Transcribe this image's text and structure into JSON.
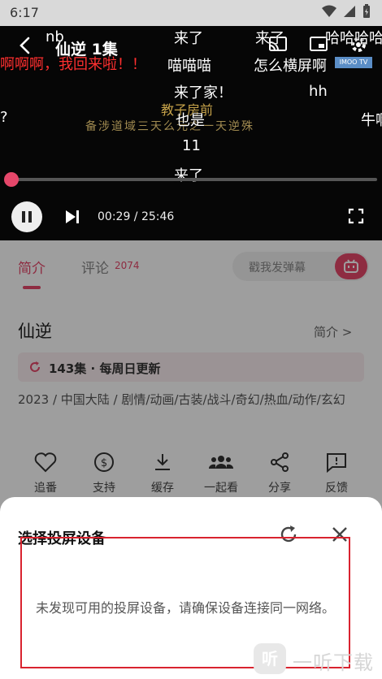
{
  "status_bar": {
    "time": "6:17"
  },
  "player": {
    "title": "仙逆 1集",
    "poster_line1": "教子房前",
    "poster_line2": "备涉道域三天么元之一天逆殊",
    "current_time": "00:29",
    "total_time": "25:46",
    "time_separator": " / ",
    "progress_fraction": 0.02,
    "watermark": "IMOO TV",
    "danmaku": [
      {
        "text": "nb",
        "color": "#ffffff"
      },
      {
        "text": "来了",
        "color": "#ffffff"
      },
      {
        "text": "来了",
        "color": "#ffffff"
      },
      {
        "text": "哈哈哈哈",
        "color": "#ffffff"
      },
      {
        "text": "啊啊啊，我回来啦！！",
        "color": "#ff3030"
      },
      {
        "text": "喵喵喵",
        "color": "#ffffff"
      },
      {
        "text": "怎么横屏啊",
        "color": "#ffffff"
      },
      {
        "text": "来了家！",
        "color": "#ffffff"
      },
      {
        "text": "hh",
        "color": "#ffffff"
      },
      {
        "text": "?",
        "color": "#ffffff"
      },
      {
        "text": "也是",
        "color": "#ffffff"
      },
      {
        "text": "牛啊",
        "color": "#ffffff"
      },
      {
        "text": "11",
        "color": "#ffffff"
      },
      {
        "text": "来了",
        "color": "#ffffff"
      }
    ]
  },
  "tabs": {
    "intro": "简介",
    "comments": "评论",
    "comments_count": "2074",
    "danmaku_placeholder": "戳我发弹幕"
  },
  "show": {
    "title": "仙逆",
    "intro_link": "简介 >",
    "update": "143集 · 每周日更新",
    "tags": "2023 / 中国大陆 / 剧情/动画/古装/战斗/奇幻/热血/动作/玄幻"
  },
  "actions": [
    {
      "label": "追番",
      "icon": "heart-icon"
    },
    {
      "label": "支持",
      "icon": "dollar-circle-icon"
    },
    {
      "label": "缓存",
      "icon": "download-icon"
    },
    {
      "label": "一起看",
      "icon": "group-icon"
    },
    {
      "label": "分享",
      "icon": "share-icon"
    },
    {
      "label": "反馈",
      "icon": "feedback-icon"
    }
  ],
  "cast_sheet": {
    "title": "选择投屏设备",
    "empty_message": "未发现可用的投屏设备，请确保设备连接同一网络。"
  },
  "watermark_site": {
    "logo": "听",
    "text": "一听下载"
  },
  "colors": {
    "accent": "#e5476a",
    "highlight_box": "#d9232f"
  }
}
